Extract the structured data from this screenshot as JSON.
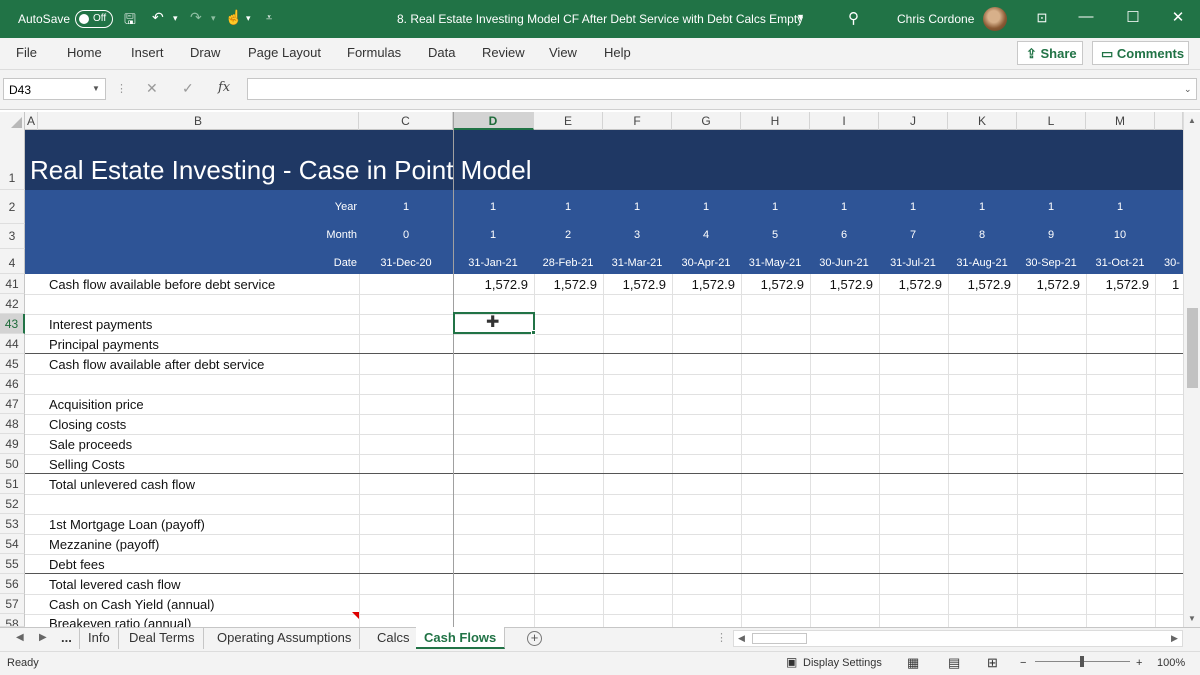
{
  "titlebar": {
    "autosave_label": "AutoSave",
    "autosave_state": "Off",
    "document_title": "8. Real Estate Investing Model CF After Debt Service with Debt Calcs Empty",
    "user_name": "Chris Cordone",
    "bg_color": "#217346"
  },
  "ribbon": {
    "tabs": [
      "File",
      "Home",
      "Insert",
      "Draw",
      "Page Layout",
      "Formulas",
      "Data",
      "Review",
      "View",
      "Help"
    ],
    "share_label": "Share",
    "comments_label": "Comments"
  },
  "formula_bar": {
    "name_box": "D43",
    "fx_label": "fx",
    "formula": ""
  },
  "columns": [
    "A",
    "B",
    "C",
    "D",
    "E",
    "F",
    "G",
    "H",
    "I",
    "J",
    "K",
    "L",
    "M"
  ],
  "selected_column": "D",
  "banner": {
    "title": "Real Estate Investing - Case in Point Model",
    "labels": {
      "year": "Year",
      "month": "Month",
      "date": "Date"
    },
    "year_values": [
      "1",
      "1",
      "1",
      "1",
      "1",
      "1",
      "1",
      "1",
      "1",
      "1",
      "1"
    ],
    "month_values": [
      "0",
      "1",
      "2",
      "3",
      "4",
      "5",
      "6",
      "7",
      "8",
      "9",
      "10"
    ],
    "date_values": [
      "31-Dec-20",
      "31-Jan-21",
      "28-Feb-21",
      "31-Mar-21",
      "30-Apr-21",
      "31-May-21",
      "30-Jun-21",
      "31-Jul-21",
      "31-Aug-21",
      "30-Sep-21",
      "31-Oct-21"
    ],
    "date_cut": "30-",
    "dark_color": "#1f3864",
    "mid_color": "#2e5496"
  },
  "row_numbers": [
    "1",
    "2",
    "3",
    "4",
    "41",
    "42",
    "43",
    "44",
    "45",
    "46",
    "47",
    "48",
    "49",
    "50",
    "51",
    "52",
    "53",
    "54",
    "55",
    "56",
    "57",
    "58"
  ],
  "selected_row": "43",
  "rows": {
    "r41": {
      "label": "Cash flow available before debt service",
      "values": [
        "1,572.9",
        "1,572.9",
        "1,572.9",
        "1,572.9",
        "1,572.9",
        "1,572.9",
        "1,572.9",
        "1,572.9",
        "1,572.9",
        "1,572.9"
      ],
      "cut": "1"
    },
    "r43": "Interest payments",
    "r44": "Principal payments",
    "r45": "Cash flow available after debt service",
    "r47": "Acquisition price",
    "r48": "Closing costs",
    "r49": "Sale proceeds",
    "r50": "Selling Costs",
    "r51": "Total unlevered cash flow",
    "r53": "1st Mortgage Loan (payoff)",
    "r54": "Mezzanine (payoff)",
    "r55": "Debt fees",
    "r56": "Total levered cash flow",
    "r57": "Cash on Cash Yield (annual)",
    "r58": "Breakeven ratio (annual)"
  },
  "sheet_tabs": {
    "more": "...",
    "tabs": [
      "Info",
      "Deal Terms",
      "Operating Assumptions",
      "Calcs",
      "Cash Flows"
    ],
    "active": "Cash Flows"
  },
  "status": {
    "ready": "Ready",
    "display_settings": "Display Settings",
    "zoom": "100%",
    "zoom_minus": "−",
    "zoom_plus": "+"
  }
}
